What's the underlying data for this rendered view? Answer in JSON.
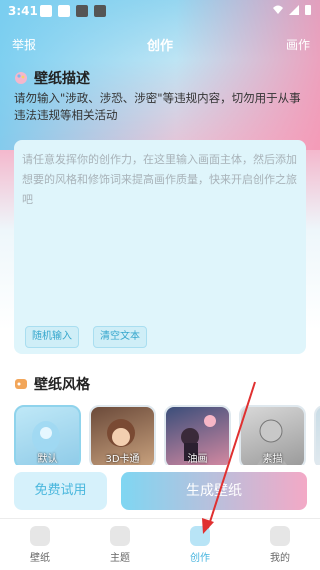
{
  "status": {
    "time": "3:41"
  },
  "header": {
    "report": "举报",
    "title": "创作",
    "gallery": "画作"
  },
  "description": {
    "title": "壁纸描述",
    "notice": "请勿输入\"涉政、涉恐、涉密\"等违规内容，切勿用于从事违法违规等相关活动",
    "placeholder": "请任意发挥你的创作力，在这里输入画面主体，然后添加想要的风格和修饰词来提高画作质量，快来开启创作之旅吧",
    "random_input": "随机输入",
    "clear_text": "清空文本"
  },
  "style": {
    "title": "壁纸风格",
    "items": [
      {
        "label": "默认",
        "selected": true
      },
      {
        "label": "3D卡通",
        "selected": false
      },
      {
        "label": "油画",
        "selected": false
      },
      {
        "label": "素描",
        "selected": false
      },
      {
        "label": "",
        "selected": false
      }
    ]
  },
  "actions": {
    "free_trial": "免费试用",
    "generate": "生成壁纸"
  },
  "tabs": [
    {
      "label": "壁纸",
      "icon": "wallpaper-icon",
      "active": false
    },
    {
      "label": "主题",
      "icon": "theme-icon",
      "active": false
    },
    {
      "label": "创作",
      "icon": "create-icon",
      "active": true
    },
    {
      "label": "我的",
      "icon": "profile-icon",
      "active": false
    }
  ]
}
